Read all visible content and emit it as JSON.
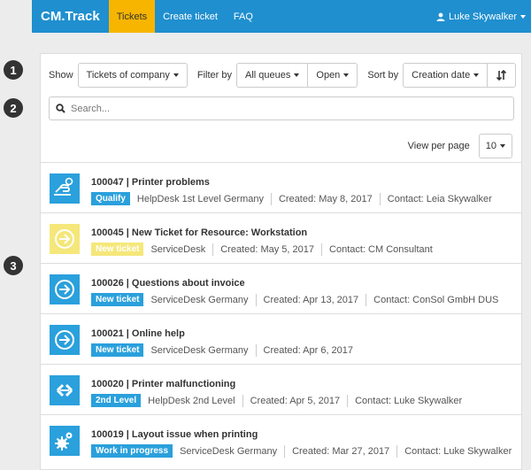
{
  "nav": {
    "brand": "CM.Track",
    "items": [
      "Tickets",
      "Create ticket",
      "FAQ"
    ],
    "user": "Luke Skywalker"
  },
  "steps": [
    "1",
    "2",
    "3"
  ],
  "filters": {
    "show_label": "Show",
    "show_value": "Tickets of company",
    "filter_label": "Filter by",
    "queue_value": "All queues",
    "status_value": "Open",
    "sort_label": "Sort by",
    "sort_value": "Creation date"
  },
  "search": {
    "placeholder": "Search..."
  },
  "perpage": {
    "label": "View per page",
    "value": "10"
  },
  "tickets": [
    {
      "title": "100047 | Printer problems",
      "status": "Qualify",
      "status_color": "#2aa0dc",
      "icon": "hand-icon",
      "icon_color": "#2aa0dc",
      "queue": "HelpDesk 1st Level Germany",
      "created": "Created: May 8, 2017",
      "contact": "Contact: Leia Skywalker"
    },
    {
      "title": "100045 | New Ticket for Resource: Workstation",
      "status": "New ticket",
      "status_color": "#f5e77a",
      "icon": "arrow-circle-icon",
      "icon_color": "#f5e77a",
      "queue": "ServiceDesk",
      "created": "Created: May 5, 2017",
      "contact": "Contact: CM Consultant"
    },
    {
      "title": "100026 | Questions about invoice",
      "status": "New ticket",
      "status_color": "#2aa0dc",
      "icon": "arrow-circle-icon",
      "icon_color": "#2aa0dc",
      "queue": "ServiceDesk Germany",
      "created": "Created: Apr 13, 2017",
      "contact": "Contact: ConSol GmbH DUS"
    },
    {
      "title": "100021 | Online help",
      "status": "New ticket",
      "status_color": "#2aa0dc",
      "icon": "arrow-circle-icon",
      "icon_color": "#2aa0dc",
      "queue": "ServiceDesk Germany",
      "created": "Created: Apr 6, 2017",
      "contact": ""
    },
    {
      "title": "100020 | Printer malfunctioning",
      "status": "2nd Level",
      "status_color": "#2aa0dc",
      "icon": "diamond-arrows-icon",
      "icon_color": "#2aa0dc",
      "queue": "HelpDesk 2nd Level",
      "created": "Created: Apr 5, 2017",
      "contact": "Contact: Luke Skywalker"
    },
    {
      "title": "100019 | Layout issue when printing",
      "status": "Work in progress",
      "status_color": "#2aa0dc",
      "icon": "gears-icon",
      "icon_color": "#2aa0dc",
      "queue": "ServiceDesk Germany",
      "created": "Created: Mar 27, 2017",
      "contact": "Contact: Luke Skywalker"
    }
  ]
}
